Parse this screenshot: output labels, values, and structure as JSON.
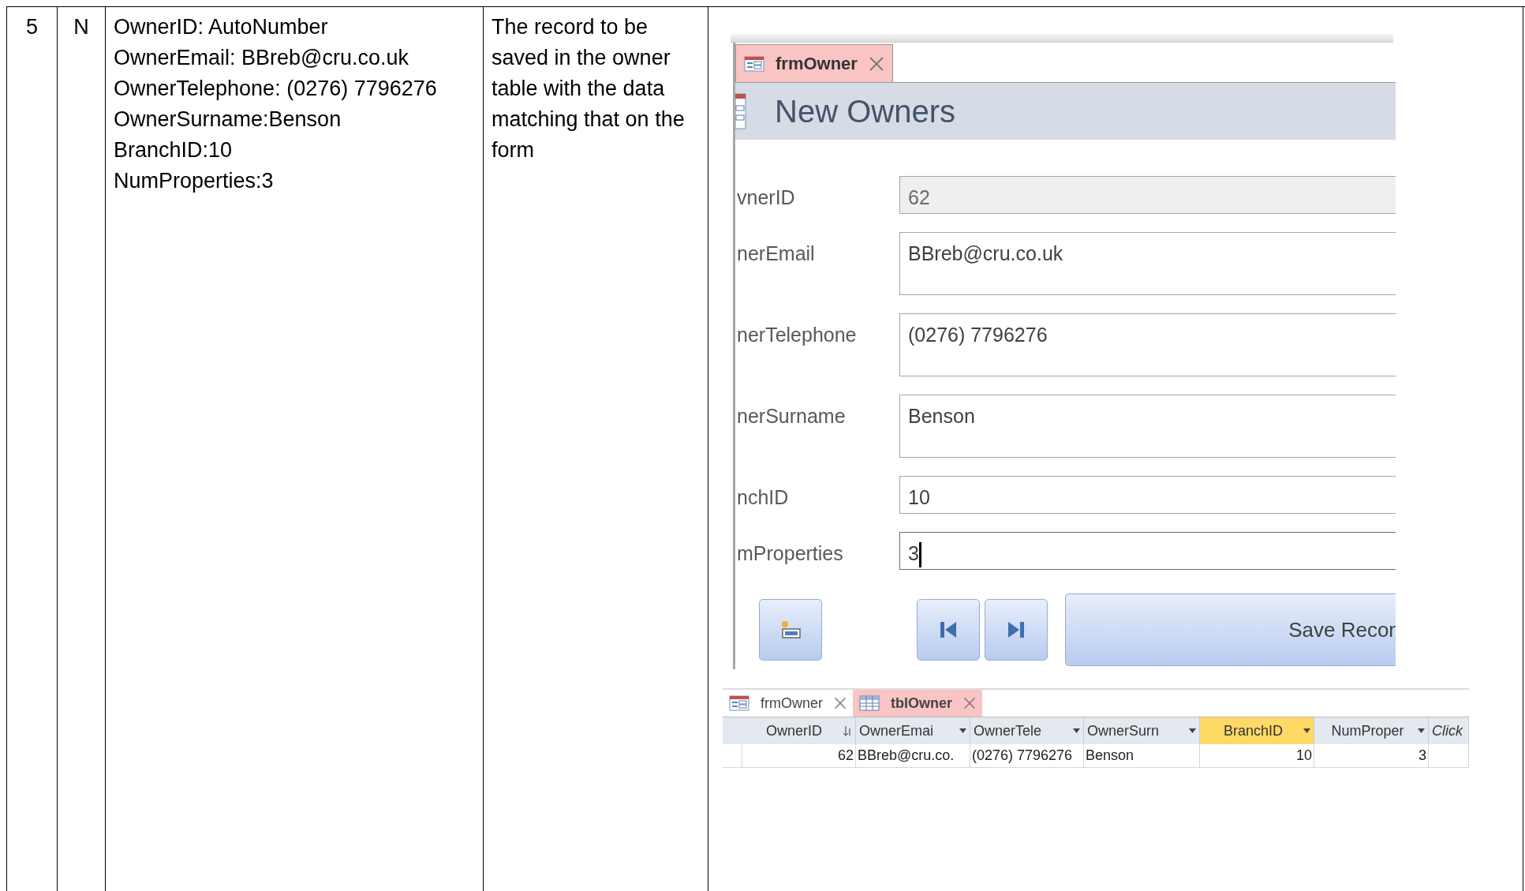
{
  "test_row": {
    "number": "5",
    "column_2": "N",
    "test_data": [
      "OwnerID: AutoNumber",
      "OwnerEmail: BBreb@cru.co.uk",
      "OwnerTelephone: (0276) 7796276",
      "OwnerSurname:Benson",
      "BranchID:10",
      "NumProperties:3"
    ],
    "expected_result": "The record to be saved in the owner table with the data matching that on the form"
  },
  "form_screenshot": {
    "tabs": [
      {
        "label": "frmOwner",
        "selected": true
      }
    ],
    "header_title": "New Owners",
    "fields": [
      {
        "label": "vnerID",
        "value": "62",
        "disabled": true,
        "tall": false,
        "focused": false
      },
      {
        "label": "nerEmail",
        "value": "BBreb@cru.co.uk",
        "disabled": false,
        "tall": true,
        "focused": false
      },
      {
        "label": "nerTelephone",
        "value": "(0276) 7796276",
        "disabled": false,
        "tall": true,
        "focused": false
      },
      {
        "label": "nerSurname",
        "value": "Benson",
        "disabled": false,
        "tall": true,
        "focused": false
      },
      {
        "label": "nchID",
        "value": "10",
        "disabled": false,
        "tall": false,
        "focused": false
      },
      {
        "label": "mProperties",
        "value": "3",
        "disabled": false,
        "tall": false,
        "focused": true
      }
    ],
    "buttons": [
      {
        "kind": "new_record"
      },
      {
        "kind": "first_record"
      },
      {
        "kind": "last_record"
      },
      {
        "kind": "text",
        "label": "Save Recor"
      }
    ]
  },
  "datasheet": {
    "tabs": [
      {
        "label": "frmOwner",
        "kind": "form",
        "selected": false
      },
      {
        "label": "tblOwner",
        "kind": "table",
        "selected": true
      }
    ],
    "columns": [
      {
        "label": "OwnerID",
        "kind": "number",
        "sorted": true,
        "selected": false
      },
      {
        "label": "OwnerEmai",
        "kind": "text",
        "sorted": false,
        "selected": false
      },
      {
        "label": "OwnerTele",
        "kind": "text",
        "sorted": false,
        "selected": false
      },
      {
        "label": "OwnerSurn",
        "kind": "text",
        "sorted": false,
        "selected": false
      },
      {
        "label": "BranchID",
        "kind": "number",
        "sorted": false,
        "selected": true
      },
      {
        "label": "NumProper",
        "kind": "number",
        "sorted": false,
        "selected": false
      },
      {
        "label": "Click",
        "kind": "add",
        "sorted": false,
        "selected": false
      }
    ],
    "rows": [
      [
        "62",
        "BBreb@cru.co.",
        "(0276) 7796276",
        "Benson",
        "10",
        "3"
      ]
    ]
  }
}
